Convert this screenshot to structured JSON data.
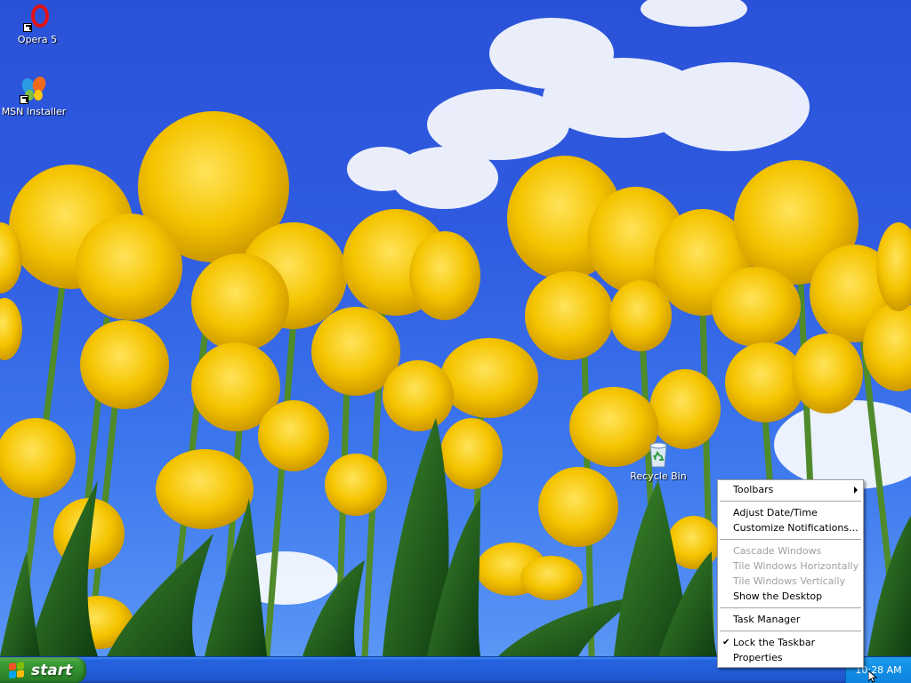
{
  "desktop": {
    "icons": [
      {
        "label": "Opera 5",
        "icon": "opera-icon"
      },
      {
        "label": "MSN Installer",
        "icon": "msn-butterfly-icon"
      },
      {
        "label": "Recycle Bin",
        "icon": "recycle-bin-icon"
      }
    ]
  },
  "taskbar": {
    "start_label": "start",
    "clock": "10:28 AM"
  },
  "context_menu": {
    "items": [
      {
        "label": "Toolbars",
        "enabled": true,
        "submenu": true
      },
      {
        "label": "Adjust Date/Time",
        "enabled": true
      },
      {
        "label": "Customize Notifications...",
        "enabled": true
      },
      {
        "label": "Cascade Windows",
        "enabled": false
      },
      {
        "label": "Tile Windows Horizontally",
        "enabled": false
      },
      {
        "label": "Tile Windows Vertically",
        "enabled": false
      },
      {
        "label": "Show the Desktop",
        "enabled": true
      },
      {
        "label": "Task Manager",
        "enabled": true
      },
      {
        "label": "Lock the Taskbar",
        "enabled": true,
        "checked": true
      },
      {
        "label": "Properties",
        "enabled": true
      }
    ]
  },
  "colors": {
    "sky": "#2f5be0",
    "tulip_yellow": "#f5c400",
    "taskbar_blue": "#245edb",
    "start_green": "#3c9e37",
    "tray_blue": "#1290e8"
  }
}
